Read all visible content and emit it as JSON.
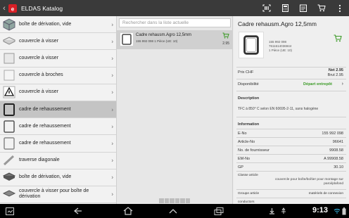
{
  "app": {
    "title": "ELDAS Katalog"
  },
  "colors": {
    "actionbar": "#3a3a3a",
    "selected_row": "#c4c4c4",
    "accent_green": "#3a9a25"
  },
  "leftlist": {
    "items": [
      {
        "label": "boîte de dérivation, vide",
        "icon": "junction-box-icon"
      },
      {
        "label": "couvercle à visser",
        "icon": "screw-cover-icon"
      },
      {
        "label": "couvercle à visser",
        "icon": "screw-cover-icon"
      },
      {
        "label": "couvercle à broches",
        "icon": "pin-cover-icon"
      },
      {
        "label": "couvercle à visser",
        "icon": "warning-cover-icon"
      },
      {
        "label": "cadre de rehaussement",
        "icon": "frame-icon"
      },
      {
        "label": "cadre de rehaussement",
        "icon": "frame-icon"
      },
      {
        "label": "cadre de rehaussement",
        "icon": "frame-icon"
      },
      {
        "label": "traverse diagonale",
        "icon": "diagonal-bar-icon"
      },
      {
        "label": "boîte de dérivation, vide",
        "icon": "junction-box-icon"
      },
      {
        "label": "couvercle à visser pour boîte de dérivation",
        "icon": "screw-cover-icon"
      }
    ]
  },
  "middle": {
    "search_placeholder": "Rechercher dans la liste actuelle",
    "result": {
      "name": "Cadre rehausm.Agro 12,5mm",
      "meta": "155 992 098    1 Pièce (UE: 10)",
      "price": "2.95"
    }
  },
  "detail": {
    "title": "Cadre rehausm.Agro 12,5mm",
    "codes": [
      "155 992 098",
      "7611614036944",
      "1 Pièce (UE: 10)"
    ],
    "price_label": "Prix CHF",
    "net_price": "Net 2.95",
    "gross_price": "Brut 2.95",
    "availability_label": "Disponibilité",
    "availability_value": "Départ entrepôt",
    "description_label": "Description",
    "description_text": "TFC à 850° C selon EN 60695-2-11, sans halogène",
    "information_label": "Information",
    "info": [
      {
        "k": "E-No",
        "v": "155 992 098"
      },
      {
        "k": "Article-No",
        "v": "96641"
      },
      {
        "k": "No. de fournisseur",
        "v": "9908.58"
      },
      {
        "k": "EM-No",
        "v": "A 99908.58"
      },
      {
        "k": "GP",
        "v": "30.10"
      }
    ],
    "class_label": "Classe article",
    "class_value": "couvercle pour boîte/boîtier pour montage sur paroi/plafond",
    "group_label": "Groupe article",
    "group_value": "matériels de connexion",
    "cut_label": "conductors"
  },
  "status": {
    "time": "9:13"
  }
}
